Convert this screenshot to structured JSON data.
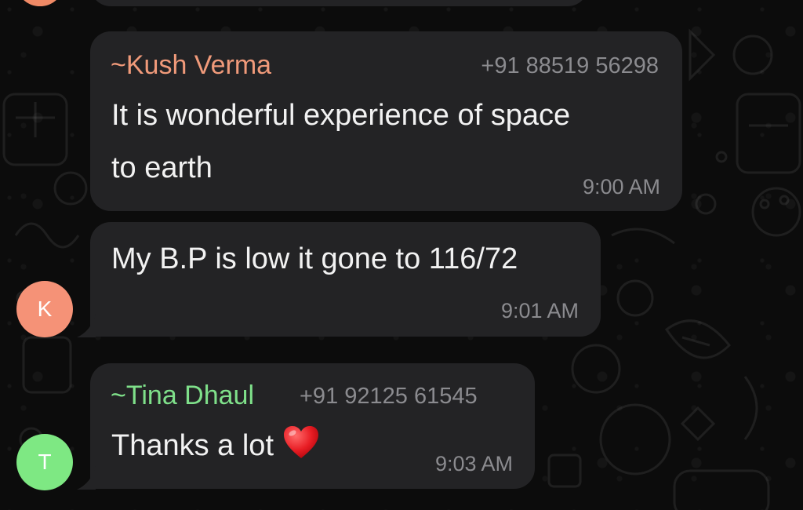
{
  "messages": [
    {
      "sender_name": "~Kush Verma",
      "sender_phone": "+91 88519 56298",
      "sender_color": "#f09a7a",
      "text_line_1": "It is wonderful experience of space",
      "text_line_2": "to earth",
      "time": "9:00 AM"
    },
    {
      "text": "My B.P is low it gone to 116/72",
      "time": "9:01 AM",
      "avatar_letter": "K",
      "avatar_color": "#f59277"
    },
    {
      "sender_name": "~Tina Dhaul",
      "sender_phone": "+91 92125 61545",
      "sender_color": "#7fe08a",
      "text": "Thanks a lot",
      "emoji_icon": "red-heart-icon",
      "time": "9:03 AM",
      "avatar_letter": "T",
      "avatar_color": "#7ee883"
    }
  ]
}
